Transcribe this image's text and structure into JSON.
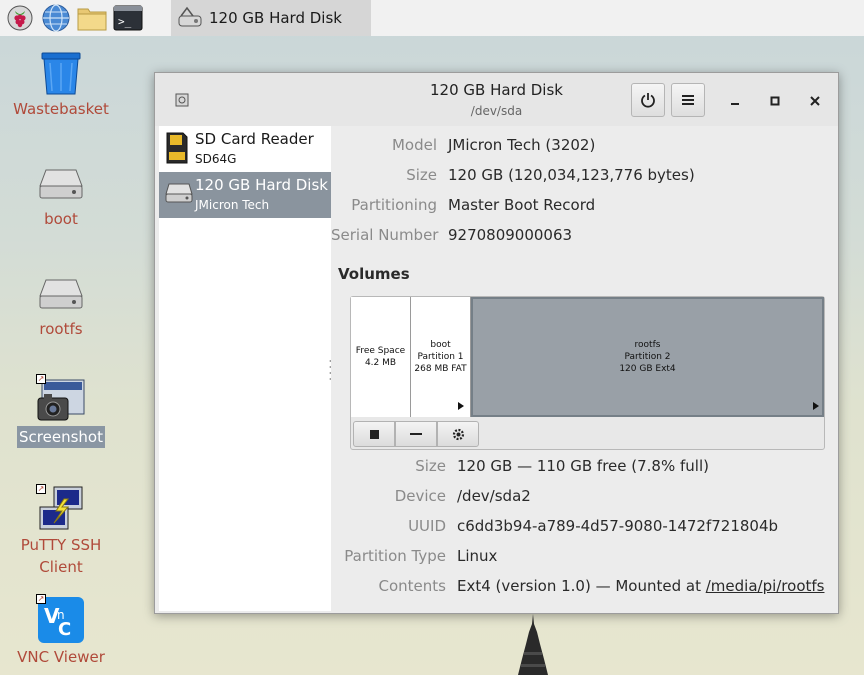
{
  "taskbar": {
    "task_title": "120 GB Hard Disk",
    "icons": [
      "raspberry-menu-icon",
      "web-browser-icon",
      "file-manager-icon",
      "terminal-icon"
    ]
  },
  "desktop": {
    "icons": [
      {
        "label": "Wastebasket",
        "icon": "wastebasket-icon"
      },
      {
        "label": "boot",
        "icon": "drive-icon"
      },
      {
        "label": "rootfs",
        "icon": "drive-icon"
      },
      {
        "label": "Screenshot",
        "icon": "camera-icon",
        "selected": true
      },
      {
        "label": "PuTTY SSH\nClient",
        "icon": "putty-icon"
      },
      {
        "label": "VNC Viewer",
        "icon": "vnc-icon"
      }
    ]
  },
  "window": {
    "title": "120 GB Hard Disk",
    "subtitle": "/dev/sda",
    "drives": [
      {
        "name": "SD Card Reader",
        "sub": "SD64G",
        "selected": false
      },
      {
        "name": "120 GB Hard Disk",
        "sub": "JMicron Tech",
        "selected": true
      }
    ],
    "disk_info": {
      "model_label": "Model",
      "model_value": "JMicron Tech (3202)",
      "size_label": "Size",
      "size_value": "120 GB (120,034,123,776 bytes)",
      "partitioning_label": "Partitioning",
      "partitioning_value": "Master Boot Record",
      "serial_label": "Serial Number",
      "serial_value": "9270809000063"
    },
    "volumes_heading": "Volumes",
    "partitions": [
      {
        "line1": "Free Space",
        "line2": "4.2 MB",
        "line3": ""
      },
      {
        "line1": "boot",
        "line2": "Partition 1",
        "line3": "268 MB FAT"
      },
      {
        "line1": "rootfs",
        "line2": "Partition 2",
        "line3": "120 GB Ext4"
      }
    ],
    "partition_info": {
      "size_label": "Size",
      "size_value": "120 GB — 110 GB free (7.8% full)",
      "device_label": "Device",
      "device_value": "/dev/sda2",
      "uuid_label": "UUID",
      "uuid_value": "c6dd3b94-a789-4d57-9080-1472f721804b",
      "ptype_label": "Partition Type",
      "ptype_value": "Linux",
      "contents_label": "Contents",
      "contents_value": "Ext4 (version 1.0) — Mounted at ",
      "mount_link": "/media/pi/rootfs"
    }
  },
  "colors": {
    "selection": "#8a949e",
    "desktop_label": "#b04a3a"
  }
}
